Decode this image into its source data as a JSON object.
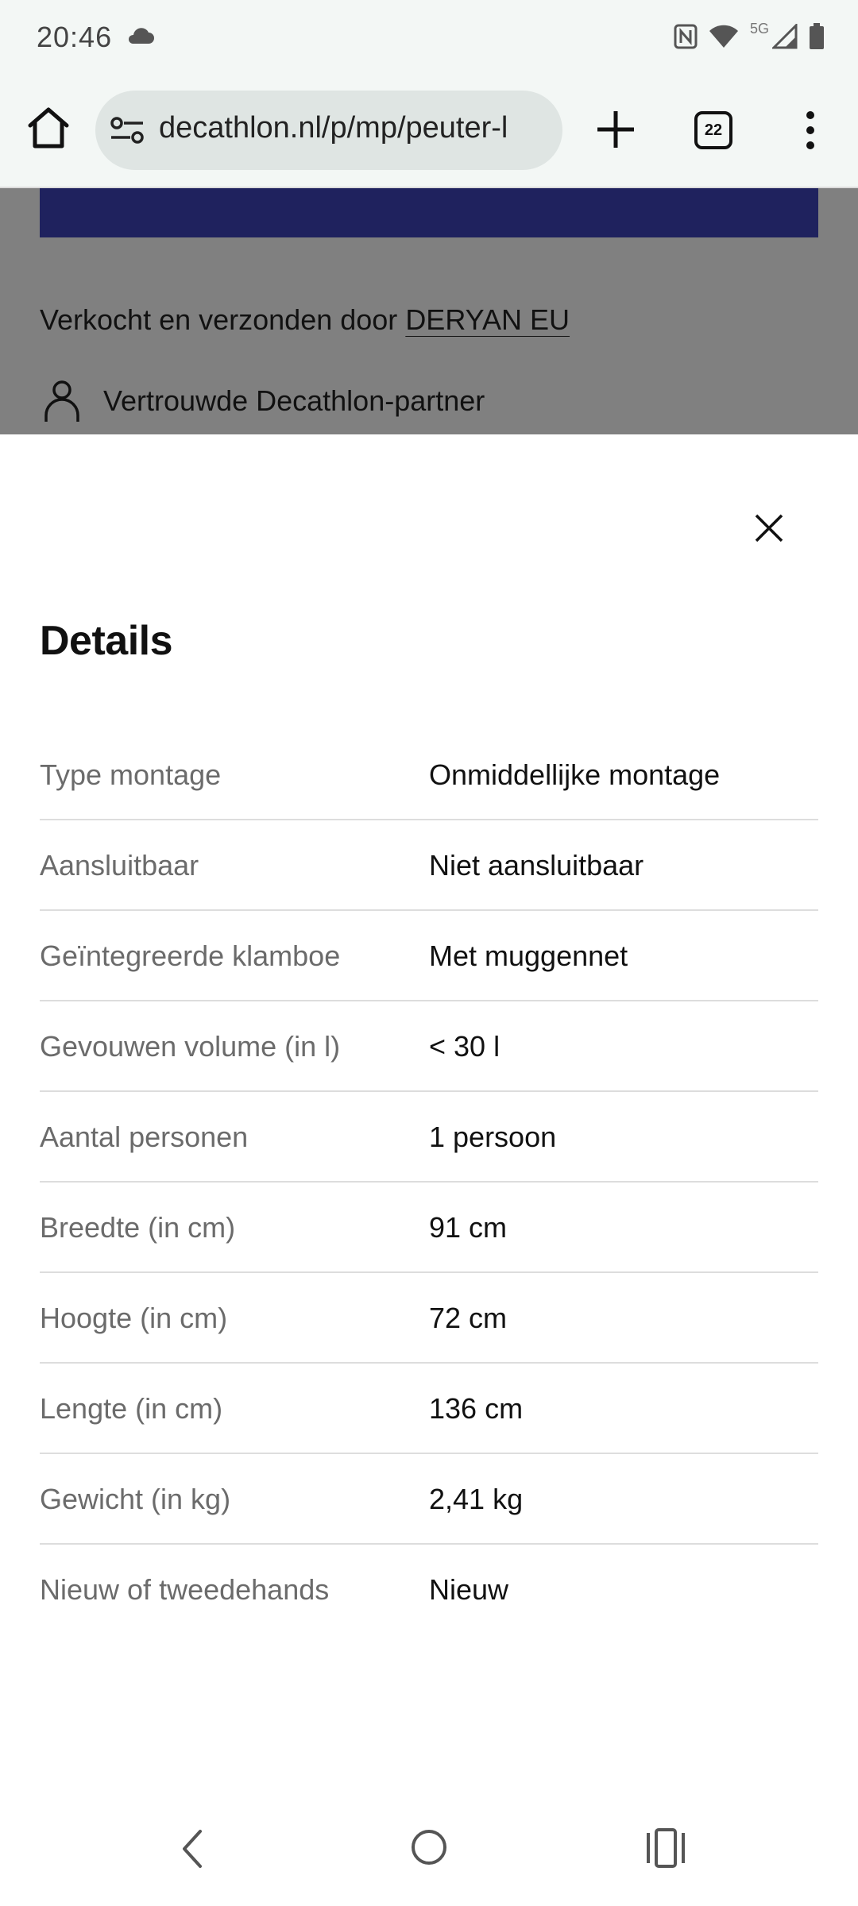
{
  "status_bar": {
    "time": "20:46",
    "network_label": "5G"
  },
  "browser": {
    "url": "decathlon.nl/p/mp/peuter-l",
    "tab_count": "22"
  },
  "underlay": {
    "sold_by_prefix": "Verkocht en verzonden door ",
    "seller_name": "DERYAN EU",
    "partner_label": "Vertrouwde Decathlon-partner",
    "banner_color": "#1f225e"
  },
  "sheet": {
    "title": "Details",
    "rows": [
      {
        "label": "Type montage",
        "value": "Onmiddellijke montage"
      },
      {
        "label": "Aansluitbaar",
        "value": "Niet aansluitbaar"
      },
      {
        "label": "Geïntegreerde klamboe",
        "value": "Met muggennet"
      },
      {
        "label": "Gevouwen volume (in l)",
        "value": "< 30 l"
      },
      {
        "label": "Aantal personen",
        "value": "1 persoon"
      },
      {
        "label": "Breedte (in cm)",
        "value": "91 cm"
      },
      {
        "label": "Hoogte (in cm)",
        "value": "72 cm"
      },
      {
        "label": "Lengte (in cm)",
        "value": "136 cm"
      },
      {
        "label": "Gewicht (in kg)",
        "value": "2,41 kg"
      },
      {
        "label": "Nieuw of tweedehands",
        "value": "Nieuw"
      }
    ]
  },
  "icons": {
    "status": [
      "cloud-icon",
      "nfc-icon",
      "wifi-icon",
      "signal-icon",
      "battery-icon"
    ],
    "toolbar": [
      "home-icon",
      "site-settings-icon",
      "plus-icon",
      "tab-switcher-icon",
      "more-vert-icon"
    ],
    "sheet": [
      "person-icon",
      "close-icon"
    ],
    "nav": [
      "back-icon",
      "home-circle-icon",
      "recents-icon"
    ]
  }
}
